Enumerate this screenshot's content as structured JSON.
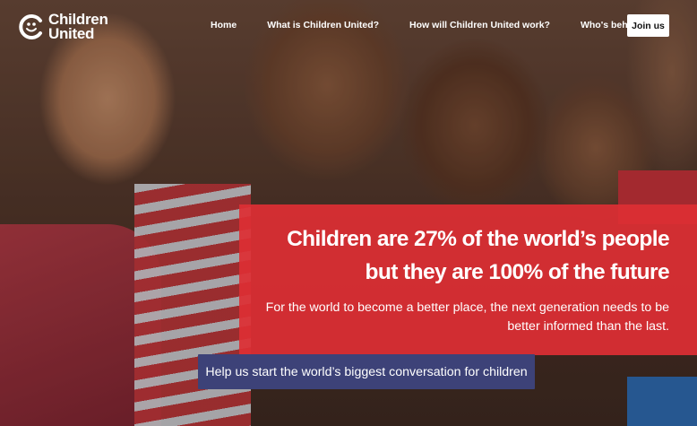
{
  "brand": {
    "line1": "Children",
    "line2": "United"
  },
  "nav": {
    "items": [
      "Home",
      "What is Children United?",
      "How will Children United work?",
      "Who's behind it?"
    ],
    "join_label": "Join us"
  },
  "hero": {
    "headline_line1": "Children are 27% of the world’s people",
    "headline_line2": "but they are 100% of the future",
    "subtext_line1": "For the world to become a better place, the next generation needs to be",
    "subtext_line2": "better informed than the last.",
    "cta_label": "Help us start the world’s biggest conversation for children"
  },
  "colors": {
    "panel_red": "#dd2e34",
    "cta_navy": "#3d4278",
    "nav_text": "#ffffff"
  },
  "icons": {
    "logo": "smiling-c-logo-icon"
  }
}
